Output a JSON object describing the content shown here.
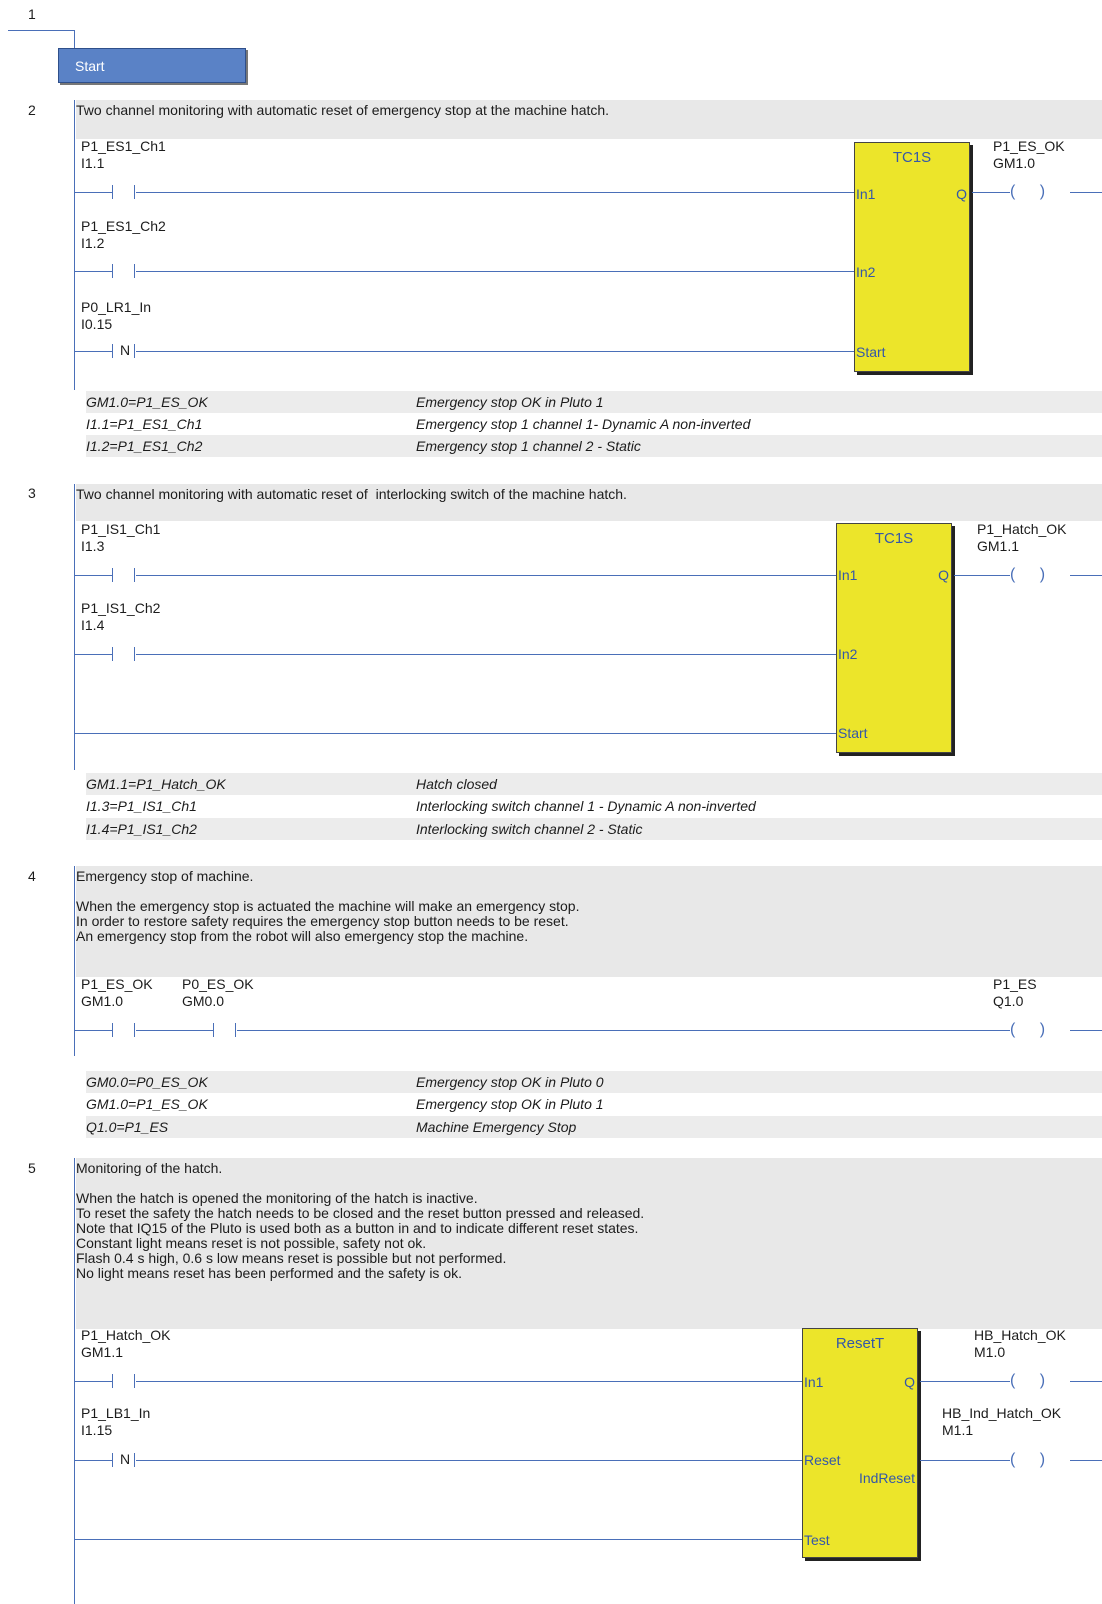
{
  "networks": [
    {
      "number": "1",
      "start_label": "Start"
    },
    {
      "number": "2",
      "comment": [
        "Two channel monitoring with automatic reset of emergency stop at the machine hatch."
      ],
      "contacts": [
        {
          "name": "P1_ES1_Ch1",
          "address": "I1.1",
          "type": ""
        },
        {
          "name": "P1_ES1_Ch2",
          "address": "I1.2",
          "type": ""
        },
        {
          "name": "P0_LR1_In",
          "address": "I0.15",
          "type": "N"
        }
      ],
      "block": {
        "title": "TC1S",
        "inputs": [
          "In1",
          "In2",
          "Start"
        ],
        "outputs": [
          "Q"
        ]
      },
      "coils": [
        {
          "name": "P1_ES_OK",
          "address": "GM1.0"
        }
      ],
      "symbols": [
        {
          "symbol": "GM1.0=P1_ES_OK",
          "comment": "Emergency stop OK in Pluto 1"
        },
        {
          "symbol": "I1.1=P1_ES1_Ch1",
          "comment": "Emergency stop 1 channel 1- Dynamic A non-inverted"
        },
        {
          "symbol": "I1.2=P1_ES1_Ch2",
          "comment": "Emergency stop 1 channel 2 - Static"
        }
      ]
    },
    {
      "number": "3",
      "comment": [
        "Two channel monitoring with automatic reset of  interlocking switch of the machine hatch."
      ],
      "contacts": [
        {
          "name": "P1_IS1_Ch1",
          "address": "I1.3",
          "type": ""
        },
        {
          "name": "P1_IS1_Ch2",
          "address": "I1.4",
          "type": ""
        }
      ],
      "block": {
        "title": "TC1S",
        "inputs": [
          "In1",
          "In2",
          "Start"
        ],
        "outputs": [
          "Q"
        ]
      },
      "coils": [
        {
          "name": "P1_Hatch_OK",
          "address": "GM1.1"
        }
      ],
      "symbols": [
        {
          "symbol": "GM1.1=P1_Hatch_OK",
          "comment": "Hatch closed"
        },
        {
          "symbol": "I1.3=P1_IS1_Ch1",
          "comment": "Interlocking switch channel 1 - Dynamic A non-inverted"
        },
        {
          "symbol": "I1.4=P1_IS1_Ch2",
          "comment": "Interlocking switch channel 2 - Static"
        }
      ]
    },
    {
      "number": "4",
      "comment": [
        "Emergency stop of machine.",
        "",
        "When the emergency stop is actuated the machine will make an emergency stop.",
        "In order to restore safety requires the emergency stop button needs to be reset.",
        "An emergency stop from the robot will also emergency stop the machine."
      ],
      "contacts": [
        {
          "name": "P1_ES_OK",
          "address": "GM1.0",
          "type": ""
        },
        {
          "name": "P0_ES_OK",
          "address": "GM0.0",
          "type": ""
        }
      ],
      "coils": [
        {
          "name": "P1_ES",
          "address": "Q1.0"
        }
      ],
      "symbols": [
        {
          "symbol": "GM0.0=P0_ES_OK",
          "comment": "Emergency stop OK in Pluto 0"
        },
        {
          "symbol": "GM1.0=P1_ES_OK",
          "comment": "Emergency stop OK in Pluto 1"
        },
        {
          "symbol": "Q1.0=P1_ES",
          "comment": "Machine Emergency Stop"
        }
      ]
    },
    {
      "number": "5",
      "comment": [
        "Monitoring of the hatch.",
        "",
        "When the hatch is opened the monitoring of the hatch is inactive.",
        "To reset the safety the hatch needs to be closed and the reset button pressed and released.",
        "Note that IQ15 of the Pluto is used both as a button in and to indicate different reset states.",
        "Constant light means reset is not possible, safety not ok.",
        "Flash 0.4 s high, 0.6 s low means reset is possible but not performed.",
        "No light means reset has been performed and the safety is ok."
      ],
      "contacts": [
        {
          "name": "P1_Hatch_OK",
          "address": "GM1.1",
          "type": ""
        },
        {
          "name": "P1_LB1_In",
          "address": "I1.15",
          "type": "N"
        }
      ],
      "block": {
        "title": "ResetT",
        "inputs": [
          "In1",
          "Reset",
          "Test"
        ],
        "outputs": [
          "Q",
          "IndReset"
        ]
      },
      "coils": [
        {
          "name": "HB_Hatch_OK",
          "address": "M1.0"
        },
        {
          "name": "HB_Ind_Hatch_OK",
          "address": "M1.1"
        }
      ]
    }
  ],
  "coil_glyph": "(   )",
  "colors": {
    "rail": "#4a6fb8",
    "block": "#ece52a",
    "start": "#5a82c6"
  }
}
